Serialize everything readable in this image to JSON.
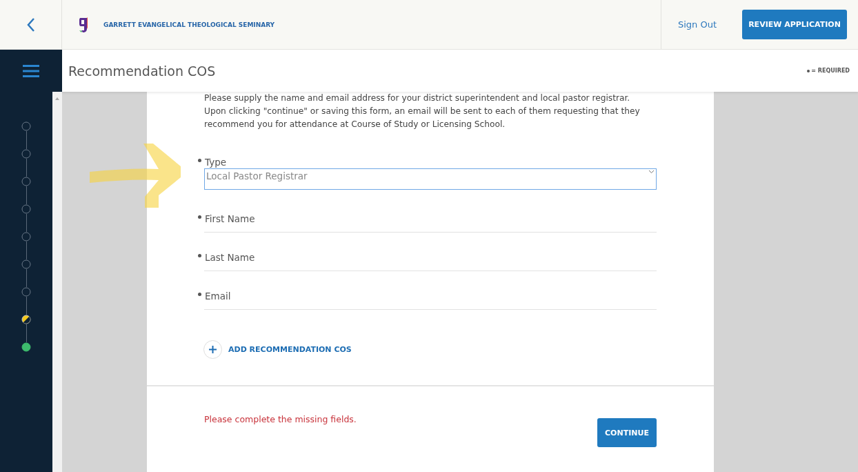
{
  "header": {
    "school_name": "GARRETT EVANGELICAL THEOLOGICAL SEMINARY",
    "sign_out": "Sign Out",
    "review_button": "REVIEW APPLICATION"
  },
  "page": {
    "title": "Recommendation COS",
    "required_note": "= REQUIRED"
  },
  "steps": [
    {
      "started": false,
      "complete": false
    },
    {
      "started": false,
      "complete": false
    },
    {
      "started": false,
      "complete": false
    },
    {
      "started": false,
      "complete": false
    },
    {
      "started": false,
      "complete": false
    },
    {
      "started": false,
      "complete": false
    },
    {
      "started": false,
      "complete": false
    },
    {
      "started": true,
      "complete": false
    },
    {
      "started": true,
      "complete": true
    }
  ],
  "form": {
    "intro": "Please supply the name and email address for your district superintendent and local pastor registrar. Upon clicking \"continue\" or saving this form, an email will be sent to each of them requesting that they recommend you for attendance at Course of Study or Licensing School.",
    "fields": [
      {
        "kind": "select",
        "label": "Type",
        "value": "Local Pastor Registrar",
        "required": true
      },
      {
        "kind": "text",
        "label": "First Name",
        "required": true
      },
      {
        "kind": "text",
        "label": "Last Name",
        "required": true
      },
      {
        "kind": "text",
        "label": "Email",
        "required": true
      }
    ],
    "add_button": "ADD RECOMMENDATION COS",
    "error": "Please complete the missing fields.",
    "continue_button": "CONTINUE"
  }
}
